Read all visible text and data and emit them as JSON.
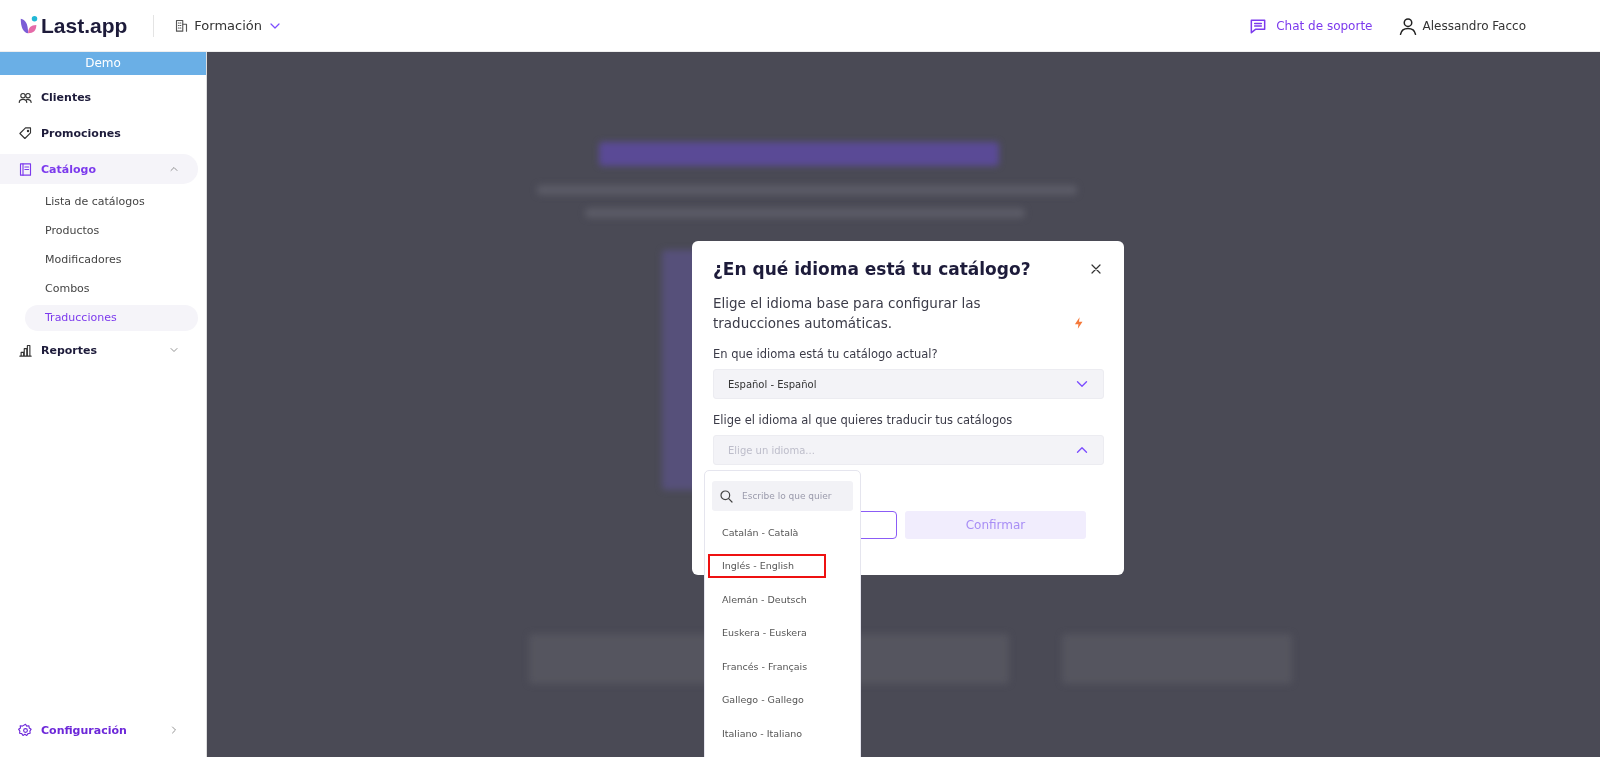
{
  "header": {
    "logo": "Last.app",
    "location": "Formación",
    "support": "Chat de soporte",
    "user": "Alessandro Facco"
  },
  "sidebar": {
    "banner": "Demo",
    "items": [
      {
        "label": "Clientes",
        "selected": false
      },
      {
        "label": "Promociones",
        "selected": false
      },
      {
        "label": "Catálogo",
        "selected": true,
        "expanded": true,
        "children": [
          {
            "label": "Lista de catálogos",
            "selected": false
          },
          {
            "label": "Productos",
            "selected": false
          },
          {
            "label": "Modificadores",
            "selected": false
          },
          {
            "label": "Combos",
            "selected": false
          },
          {
            "label": "Traducciones",
            "selected": true
          }
        ]
      },
      {
        "label": "Reportes",
        "selected": false,
        "expanded": false
      }
    ],
    "footer": {
      "label": "Configuración",
      "selected": false
    }
  },
  "modal": {
    "title": "¿En qué idioma está tu catálogo?",
    "description": "Elige el idioma base para configurar las traducciones automáticas.",
    "field_1": {
      "label": "En que idioma está tu catálogo actual?",
      "value": "Español - Español",
      "expanded": false
    },
    "field_2": {
      "label": "Elige el idioma al que quieres traducir tus catálogos",
      "placeholder": "Elige un idioma...",
      "expanded": true
    },
    "confirm": {
      "label": "Confirmar",
      "disabled": true
    },
    "dropdown": {
      "search_placeholder": "Escribe lo que quier",
      "options": [
        {
          "label": "Catalán - Català",
          "highlighted": false
        },
        {
          "label": "Inglés - English",
          "highlighted": true
        },
        {
          "label": "Alemán - Deutsch",
          "highlighted": false
        },
        {
          "label": "Euskera - Euskera",
          "highlighted": false
        },
        {
          "label": "Francés - Français",
          "highlighted": false
        },
        {
          "label": "Gallego - Gallego",
          "highlighted": false
        },
        {
          "label": "Italiano - Italiano",
          "highlighted": false
        }
      ]
    }
  }
}
